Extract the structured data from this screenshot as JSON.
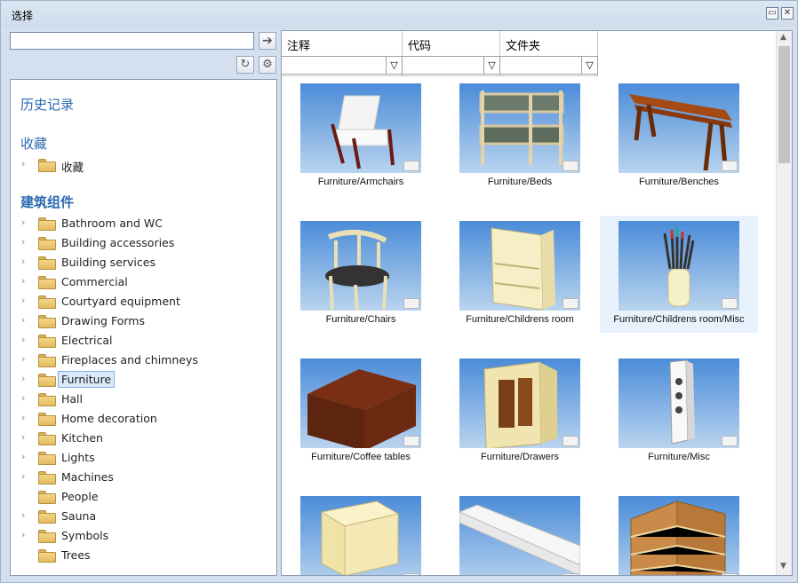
{
  "window": {
    "title": "选择"
  },
  "left": {
    "search": {
      "value": "",
      "placeholder": ""
    },
    "history_label": "历史记录",
    "favorites_label": "收藏",
    "favorites_items": [
      {
        "label": "收藏"
      }
    ],
    "building_label": "建筑组件",
    "building_items": [
      {
        "label": "Bathroom and WC",
        "expand": true
      },
      {
        "label": "Building accessories",
        "expand": true
      },
      {
        "label": "Building services",
        "expand": true
      },
      {
        "label": "Commercial",
        "expand": true
      },
      {
        "label": "Courtyard equipment",
        "expand": true
      },
      {
        "label": "Drawing Forms",
        "expand": true
      },
      {
        "label": "Electrical",
        "expand": true
      },
      {
        "label": "Fireplaces and chimneys",
        "expand": true
      },
      {
        "label": "Furniture",
        "expand": true,
        "selected": true
      },
      {
        "label": "Hall",
        "expand": true
      },
      {
        "label": "Home decoration",
        "expand": true
      },
      {
        "label": "Kitchen",
        "expand": true
      },
      {
        "label": "Lights",
        "expand": true
      },
      {
        "label": "Machines",
        "expand": true
      },
      {
        "label": "People",
        "expand": false
      },
      {
        "label": "Sauna",
        "expand": true
      },
      {
        "label": "Symbols",
        "expand": true
      },
      {
        "label": "Trees",
        "expand": false
      }
    ]
  },
  "columns": [
    {
      "label": "注释"
    },
    {
      "label": "代码"
    },
    {
      "label": "文件夹"
    }
  ],
  "tiles": [
    {
      "caption": "Furniture/Armchairs",
      "kind": "armchair-icon"
    },
    {
      "caption": "Furniture/Beds",
      "kind": "bunkbed-icon"
    },
    {
      "caption": "Furniture/Benches",
      "kind": "bench-icon"
    },
    {
      "caption": "Furniture/Chairs",
      "kind": "chair-icon"
    },
    {
      "caption": "Furniture/Childrens room",
      "kind": "shelf-icon"
    },
    {
      "caption": "Furniture/Childrens room/Misc",
      "kind": "pencil-cup-icon",
      "selected": true
    },
    {
      "caption": "Furniture/Coffee tables",
      "kind": "chest-icon"
    },
    {
      "caption": "Furniture/Drawers",
      "kind": "cabinet-icon"
    },
    {
      "caption": "Furniture/Misc",
      "kind": "speaker-icon"
    },
    {
      "caption": "",
      "kind": "nightstand-icon"
    },
    {
      "caption": "",
      "kind": "wall-shelf-icon"
    },
    {
      "caption": "",
      "kind": "corner-shelf-icon"
    }
  ],
  "colors": {
    "accent": "#2c6ab0",
    "selection": "#dbeafa",
    "sky_top": "#4b8cd8",
    "sky_bottom": "#b9d4ef"
  }
}
